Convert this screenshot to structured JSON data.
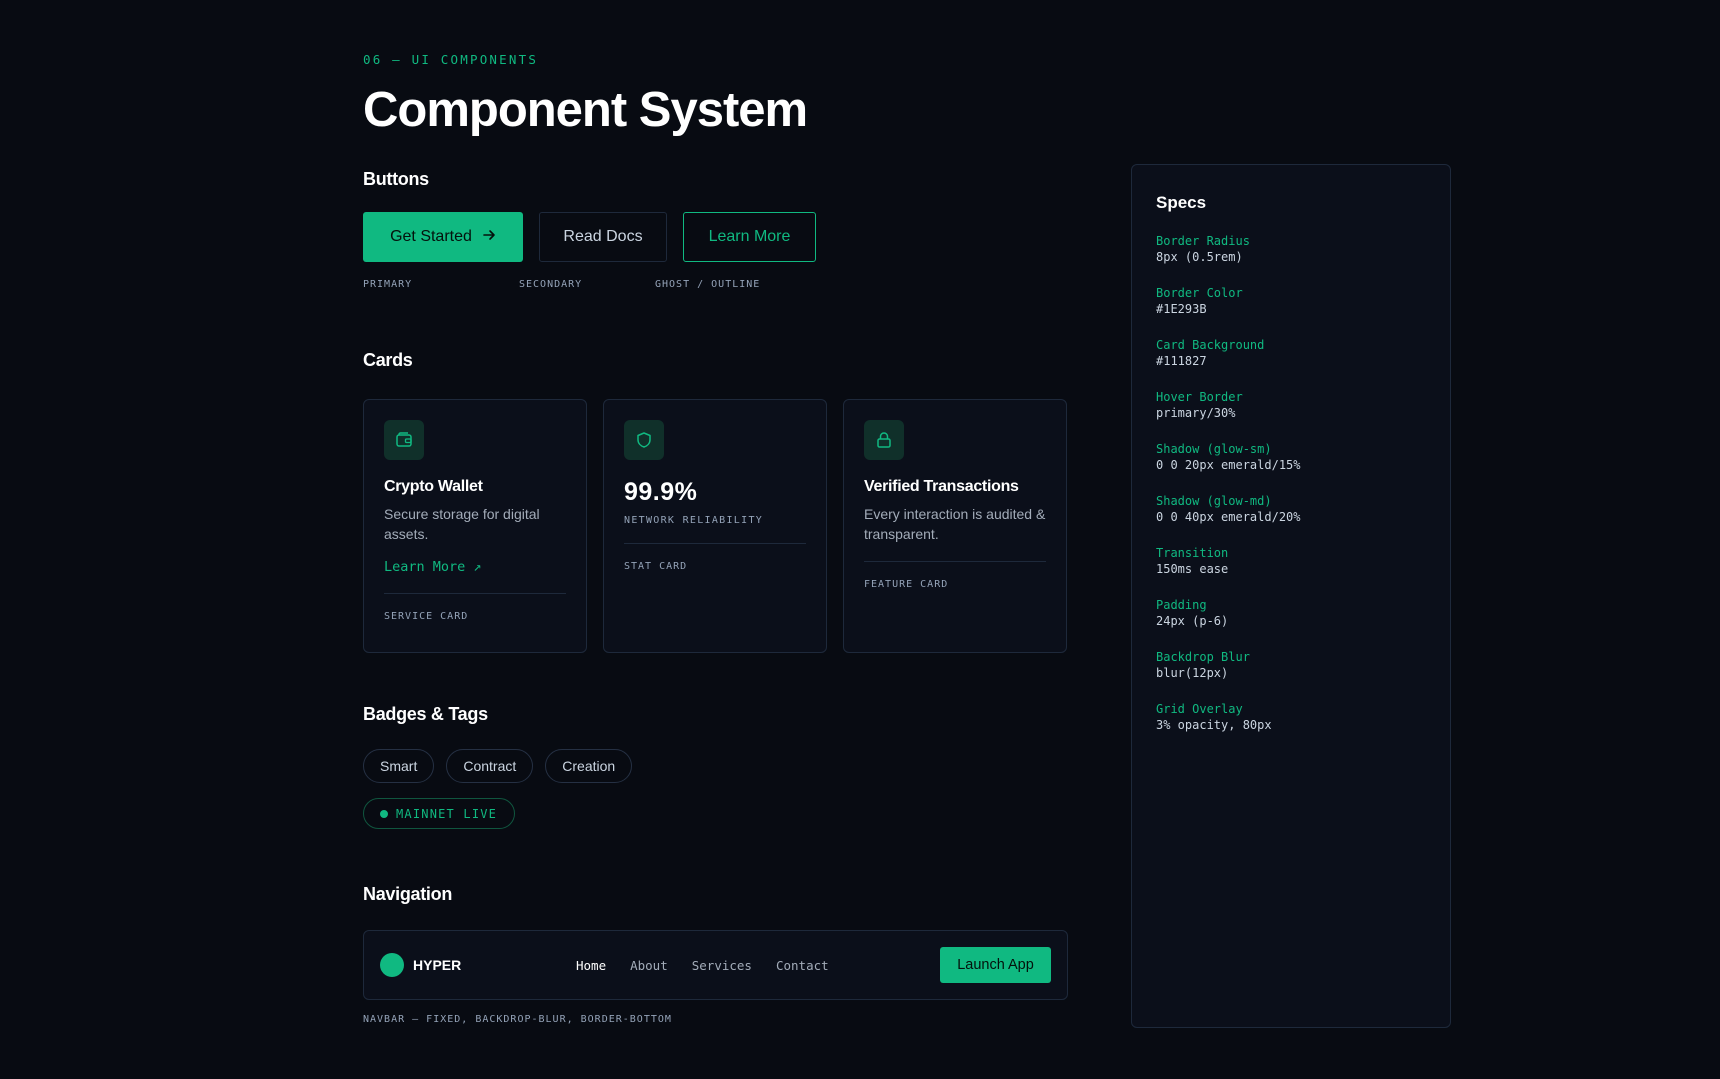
{
  "header": {
    "eyebrow": "06 — UI COMPONENTS",
    "title": "Component System"
  },
  "buttons": {
    "section_title": "Buttons",
    "primary_label": "Get Started",
    "primary_icon": "arrow-right-icon",
    "secondary_label": "Read Docs",
    "ghost_label": "Learn More",
    "captions": [
      "PRIMARY",
      "SECONDARY",
      "GHOST / OUTLINE"
    ]
  },
  "cards": {
    "section_title": "Cards",
    "service": {
      "icon": "wallet-icon",
      "title": "Crypto Wallet",
      "description": "Secure storage for digital assets.",
      "link": "Learn More ↗",
      "caption": "SERVICE CARD"
    },
    "stat": {
      "icon": "shield-icon",
      "value": "99.9%",
      "label": "NETWORK RELIABILITY",
      "caption": "STAT CARD"
    },
    "feature": {
      "icon": "lock-icon",
      "title": "Verified Transactions",
      "description": "Every interaction is audited & transparent.",
      "caption": "FEATURE CARD"
    }
  },
  "badges": {
    "section_title": "Badges & Tags",
    "tags": [
      "Smart",
      "Contract",
      "Creation"
    ],
    "live": "MAINNET LIVE"
  },
  "navigation": {
    "section_title": "Navigation",
    "brand": "HYPER",
    "links": [
      "Home",
      "About",
      "Services",
      "Contact"
    ],
    "active_link": "Home",
    "cta": "Launch App",
    "caption": "NAVBAR — FIXED, BACKDROP-BLUR, BORDER-BOTTOM"
  },
  "specs": {
    "title": "Specs",
    "items": [
      {
        "key": "Border Radius",
        "value": "8px (0.5rem)"
      },
      {
        "key": "Border Color",
        "value": "#1E293B"
      },
      {
        "key": "Card Background",
        "value": "#111827"
      },
      {
        "key": "Hover Border",
        "value": "primary/30%"
      },
      {
        "key": "Shadow (glow-sm)",
        "value": "0 0 20px emerald/15%"
      },
      {
        "key": "Shadow (glow-md)",
        "value": "0 0 40px emerald/20%"
      },
      {
        "key": "Transition",
        "value": "150ms ease"
      },
      {
        "key": "Padding",
        "value": "24px (p-6)"
      },
      {
        "key": "Backdrop Blur",
        "value": "blur(12px)"
      },
      {
        "key": "Grid Overlay",
        "value": "3% opacity, 80px"
      }
    ]
  },
  "colors": {
    "background": "#080b12",
    "accent": "#10b981",
    "border": "#1e293b",
    "card": "#0b0f1a"
  }
}
